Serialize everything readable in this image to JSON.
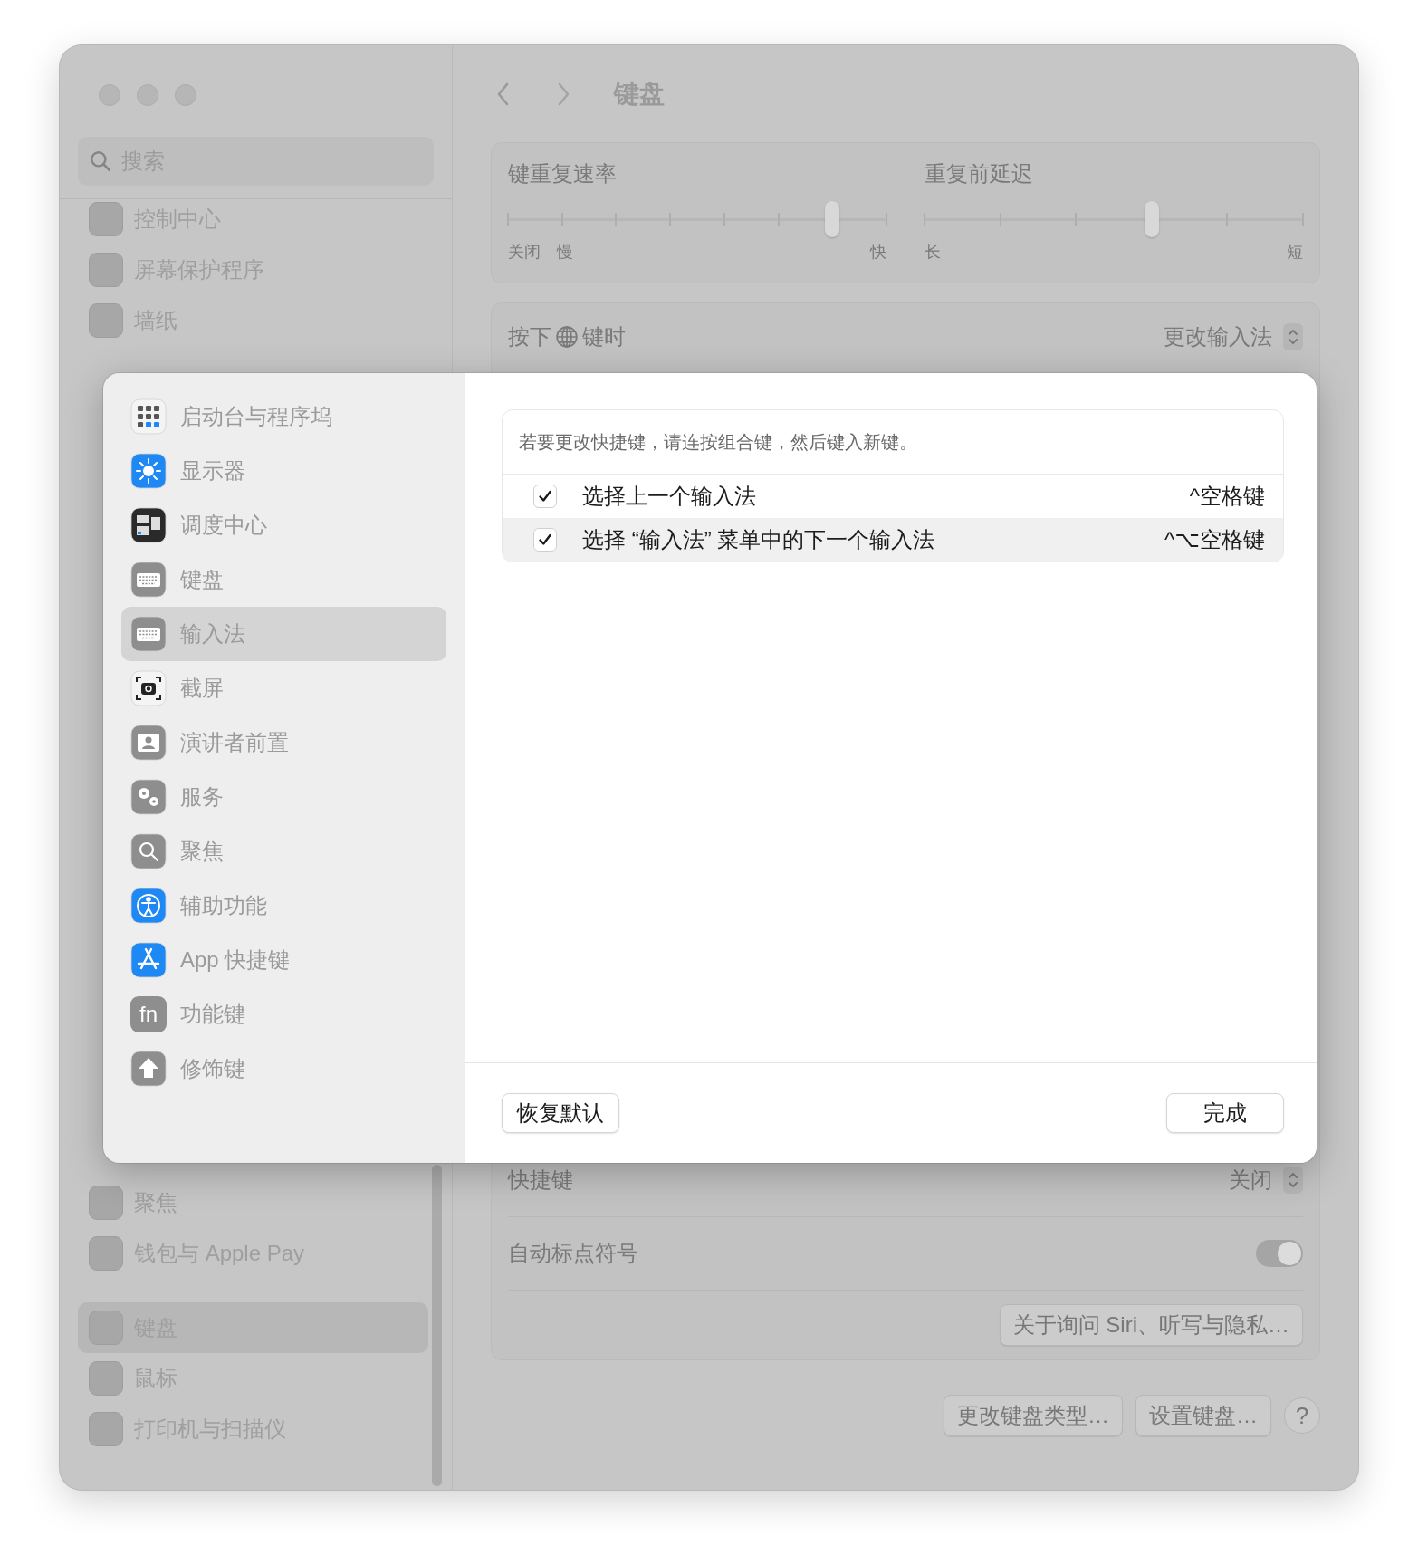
{
  "search": {
    "placeholder": "搜索"
  },
  "sidebar": {
    "groups": [
      [
        {
          "label": "控制中心",
          "selected": false
        },
        {
          "label": "屏幕保护程序",
          "selected": false
        },
        {
          "label": "墙纸",
          "selected": false
        }
      ],
      [
        {
          "label": "聚焦",
          "selected": false
        },
        {
          "label": "钱包与 Apple Pay",
          "selected": false
        }
      ],
      [
        {
          "label": "键盘",
          "selected": true
        },
        {
          "label": "鼠标",
          "selected": false
        },
        {
          "label": "打印机与扫描仪",
          "selected": false
        }
      ]
    ]
  },
  "header": {
    "title": "键盘"
  },
  "repeat_card": {
    "sliders": [
      {
        "title": "键重复速率",
        "level": 0.857,
        "labels_left": [
          "关闭",
          "慢"
        ],
        "label_right": "快"
      },
      {
        "title": "重复前延迟",
        "level": 0.6,
        "labels_left": [
          "长"
        ],
        "label_right": "短"
      }
    ]
  },
  "globe_row": {
    "label_before": "按下",
    "label_after": "键时",
    "value": "更改输入法"
  },
  "lower_rows": [
    {
      "kind": "popup",
      "label": "快捷键",
      "value": "关闭"
    },
    {
      "kind": "toggle",
      "label": "自动标点符号",
      "on": true
    },
    {
      "kind": "button",
      "label": "关于询问 Siri、听写与隐私…"
    }
  ],
  "footer_buttons": [
    "更改键盘类型…",
    "设置键盘…",
    "?"
  ],
  "sheet": {
    "categories": [
      {
        "label": "启动台与程序坞",
        "selected": false
      },
      {
        "label": "显示器",
        "selected": false
      },
      {
        "label": "调度中心",
        "selected": false
      },
      {
        "label": "键盘",
        "selected": false
      },
      {
        "label": "输入法",
        "selected": true
      },
      {
        "label": "截屏",
        "selected": false
      },
      {
        "label": "演讲者前置",
        "selected": false
      },
      {
        "label": "服务",
        "selected": false
      },
      {
        "label": "聚焦",
        "selected": false
      },
      {
        "label": "辅助功能",
        "selected": false
      },
      {
        "label": "App 快捷键",
        "selected": false
      },
      {
        "label": "功能键",
        "selected": false,
        "icon_text": "fn"
      },
      {
        "label": "修饰键",
        "selected": false
      }
    ],
    "hint": "若要更改快捷键，请连按组合键，然后键入新键。",
    "shortcuts": [
      {
        "label": "选择上一个输入法",
        "keys": "^空格键",
        "checked": true,
        "selected": false
      },
      {
        "label": "选择 “输入法” 菜单中的下一个输入法",
        "keys": "^⌥空格键",
        "checked": true,
        "selected": true
      }
    ],
    "restore_button": "恢复默认",
    "done_button": "完成"
  }
}
